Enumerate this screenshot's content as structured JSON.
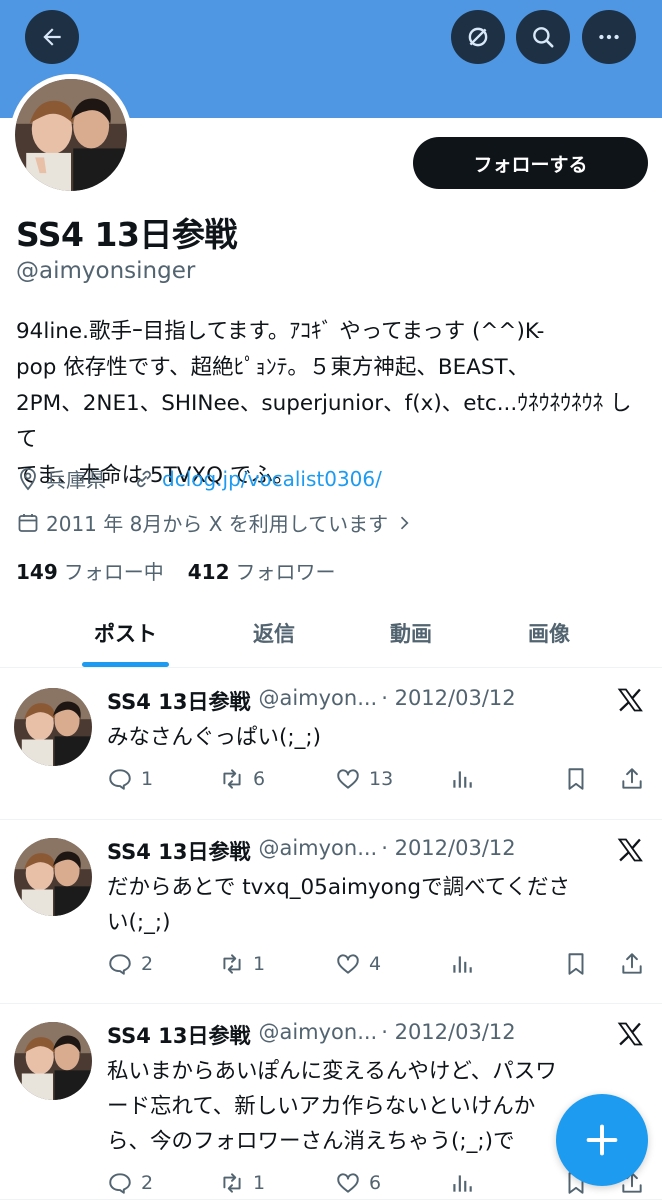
{
  "header": {
    "back_icon": "arrow-left-icon",
    "icons": [
      "hide-icon",
      "search-icon",
      "more-icon"
    ]
  },
  "profile": {
    "display_name": "SS4 13日参戦",
    "handle": "@aimyonsinger",
    "follow_label": "フォローする",
    "bio_lines": [
      "94line.歌手ｰ目指してます。ｱｺｷﾞ やってまっす (^^)K-",
      "pop 依存性です、超絶ﾋﾟｮﾝﾃ。５東方神起、BEAST、",
      "2PM、2NE1、SHINee、superjunior、f(x)、etc...ｳﾈｳﾈｳﾈｳﾈ して",
      "てま、本命は 5TVXQ でふ。"
    ],
    "location": "兵庫県",
    "website": "dclog.jp/vocalist0306/",
    "joined": "2011 年 8月から X を利用しています",
    "following_count": "149",
    "following_label": "フォロー中",
    "followers_count": "412",
    "followers_label": "フォロワー"
  },
  "tabs": [
    "ポスト",
    "返信",
    "動画",
    "画像"
  ],
  "active_tab": "ポスト",
  "posts": [
    {
      "name": "SS4 13日参戦",
      "handle": "@aimyon...",
      "date": "· 2012/03/12",
      "text_lines": [
        "みなさんぐっぱい(;_;)"
      ],
      "replies": "1",
      "reposts": "6",
      "likes": "13"
    },
    {
      "name": "SS4 13日参戦",
      "handle": "@aimyon...",
      "date": "· 2012/03/12",
      "text_lines": [
        "だからあとで tvxq_05aimyongで調べてくださ",
        "い(;_;)"
      ],
      "replies": "2",
      "reposts": "1",
      "likes": "4"
    },
    {
      "name": "SS4 13日参戦",
      "handle": "@aimyon...",
      "date": "· 2012/03/12",
      "text_lines": [
        "私いまからあいぽんに変えるんやけど、パスワ",
        "ード忘れて、新しいアカ作らないといけんか",
        "ら、今のフォロワーさん消えちゃう(;_;)で"
      ],
      "replies": "2",
      "reposts": "1",
      "likes": "6"
    }
  ],
  "fab_icon": "compose-plus-icon",
  "colors": {
    "banner": "#4f97e2",
    "accent": "#1d9bf0",
    "text": "#0f1419",
    "secondary": "#536471"
  }
}
